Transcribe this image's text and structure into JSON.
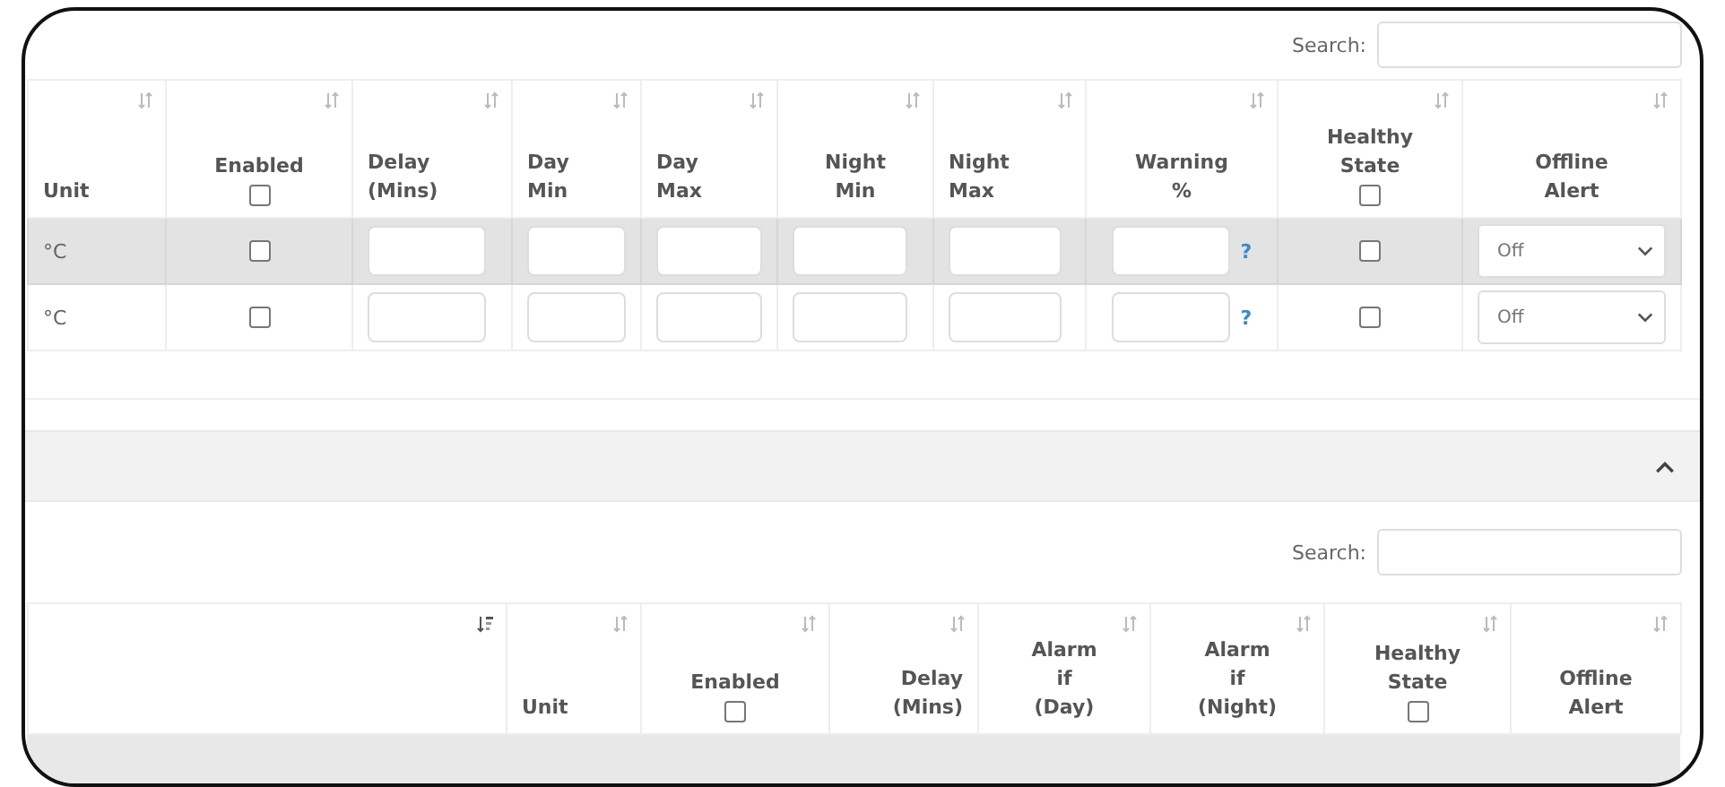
{
  "top_search": {
    "label": "Search:"
  },
  "table_1": {
    "columns": [
      {
        "label": "Unit",
        "sorted": false
      },
      {
        "label": "Enabled",
        "sorted": false,
        "checkbox_checked": false
      },
      {
        "label": "Delay\n(Mins)",
        "sorted": false
      },
      {
        "label": "Day\nMin",
        "sorted": false
      },
      {
        "label": "Day\nMax",
        "sorted": false
      },
      {
        "label": "Night\nMin",
        "sorted": false
      },
      {
        "label": "Night\nMax",
        "sorted": false
      },
      {
        "label": "Warning\n%",
        "sorted": false
      },
      {
        "label": "Healthy\nState",
        "sorted": false,
        "checkbox_checked": false
      },
      {
        "label": "Offline\nAlert",
        "sorted": false
      }
    ],
    "rows": [
      {
        "shaded": true,
        "cells": [
          {
            "kind": "text",
            "text": "°C"
          },
          {
            "kind": "checkbox",
            "checked": false
          },
          {
            "kind": "input"
          },
          {
            "kind": "input"
          },
          {
            "kind": "input"
          },
          {
            "kind": "input"
          },
          {
            "kind": "input"
          },
          {
            "kind": "input-help",
            "help": "?"
          },
          {
            "kind": "checkbox",
            "checked": false
          },
          {
            "kind": "select",
            "value": "Off"
          }
        ]
      },
      {
        "shaded": false,
        "cells": [
          {
            "kind": "text",
            "text": "°C"
          },
          {
            "kind": "checkbox",
            "checked": false
          },
          {
            "kind": "input"
          },
          {
            "kind": "input"
          },
          {
            "kind": "input"
          },
          {
            "kind": "input"
          },
          {
            "kind": "input"
          },
          {
            "kind": "input-help",
            "help": "?"
          },
          {
            "kind": "checkbox",
            "checked": false
          },
          {
            "kind": "select",
            "value": "Off"
          }
        ]
      }
    ]
  },
  "panel": {
    "expanded": true
  },
  "bottom_search": {
    "label": "Search:"
  },
  "table_2": {
    "columns": [
      {
        "sorted": true
      },
      {
        "label": "Unit",
        "sorted": false
      },
      {
        "label": "Enabled",
        "sorted": false,
        "checkbox_checked": false
      },
      {
        "label": "Delay\n(Mins)",
        "sorted": false
      },
      {
        "label": "Alarm\nif\n(Day)",
        "sorted": false
      },
      {
        "label": "Alarm\nif\n(Night)",
        "sorted": false
      },
      {
        "label": "Healthy\nState",
        "sorted": false,
        "checkbox_checked": false
      },
      {
        "label": "Offline\nAlert",
        "sorted": false
      }
    ]
  }
}
